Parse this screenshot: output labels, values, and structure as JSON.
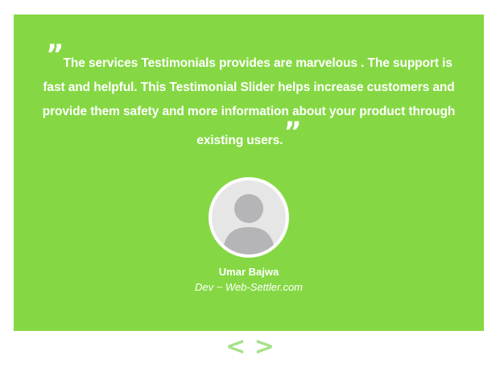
{
  "testimonial": {
    "open_quote": "”",
    "text": "The services Testimonials provides are marvelous . The support is fast and helpful. This Testimonial Slider helps increase customers and provide them safety and more information about your product through existing users.",
    "close_quote": "”",
    "author_name": "Umar Bajwa",
    "author_role": "Dev ~ Web-Settler.com"
  },
  "nav": {
    "prev_label": "<",
    "next_label": ">"
  },
  "colors": {
    "card_background": "#85d843",
    "nav_arrows": "#a8e08a",
    "avatar_background": "#e6e6e7",
    "avatar_figure": "#b5b5b7"
  },
  "icons": {
    "avatar": "user-placeholder-icon",
    "prev": "chevron-left-icon",
    "next": "chevron-right-icon"
  }
}
